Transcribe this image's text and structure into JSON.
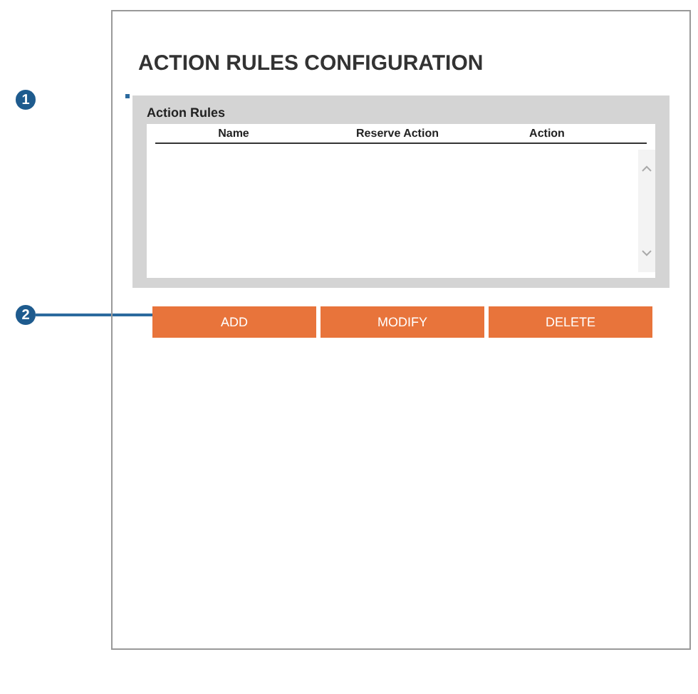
{
  "callouts": [
    {
      "label": "1"
    },
    {
      "label": "2"
    }
  ],
  "page": {
    "title": "ACTION RULES CONFIGURATION"
  },
  "panel": {
    "title": "Action Rules",
    "columns": [
      "Name",
      "Reserve Action",
      "Action"
    ]
  },
  "buttons": [
    "ADD",
    "MODIFY",
    "DELETE"
  ]
}
